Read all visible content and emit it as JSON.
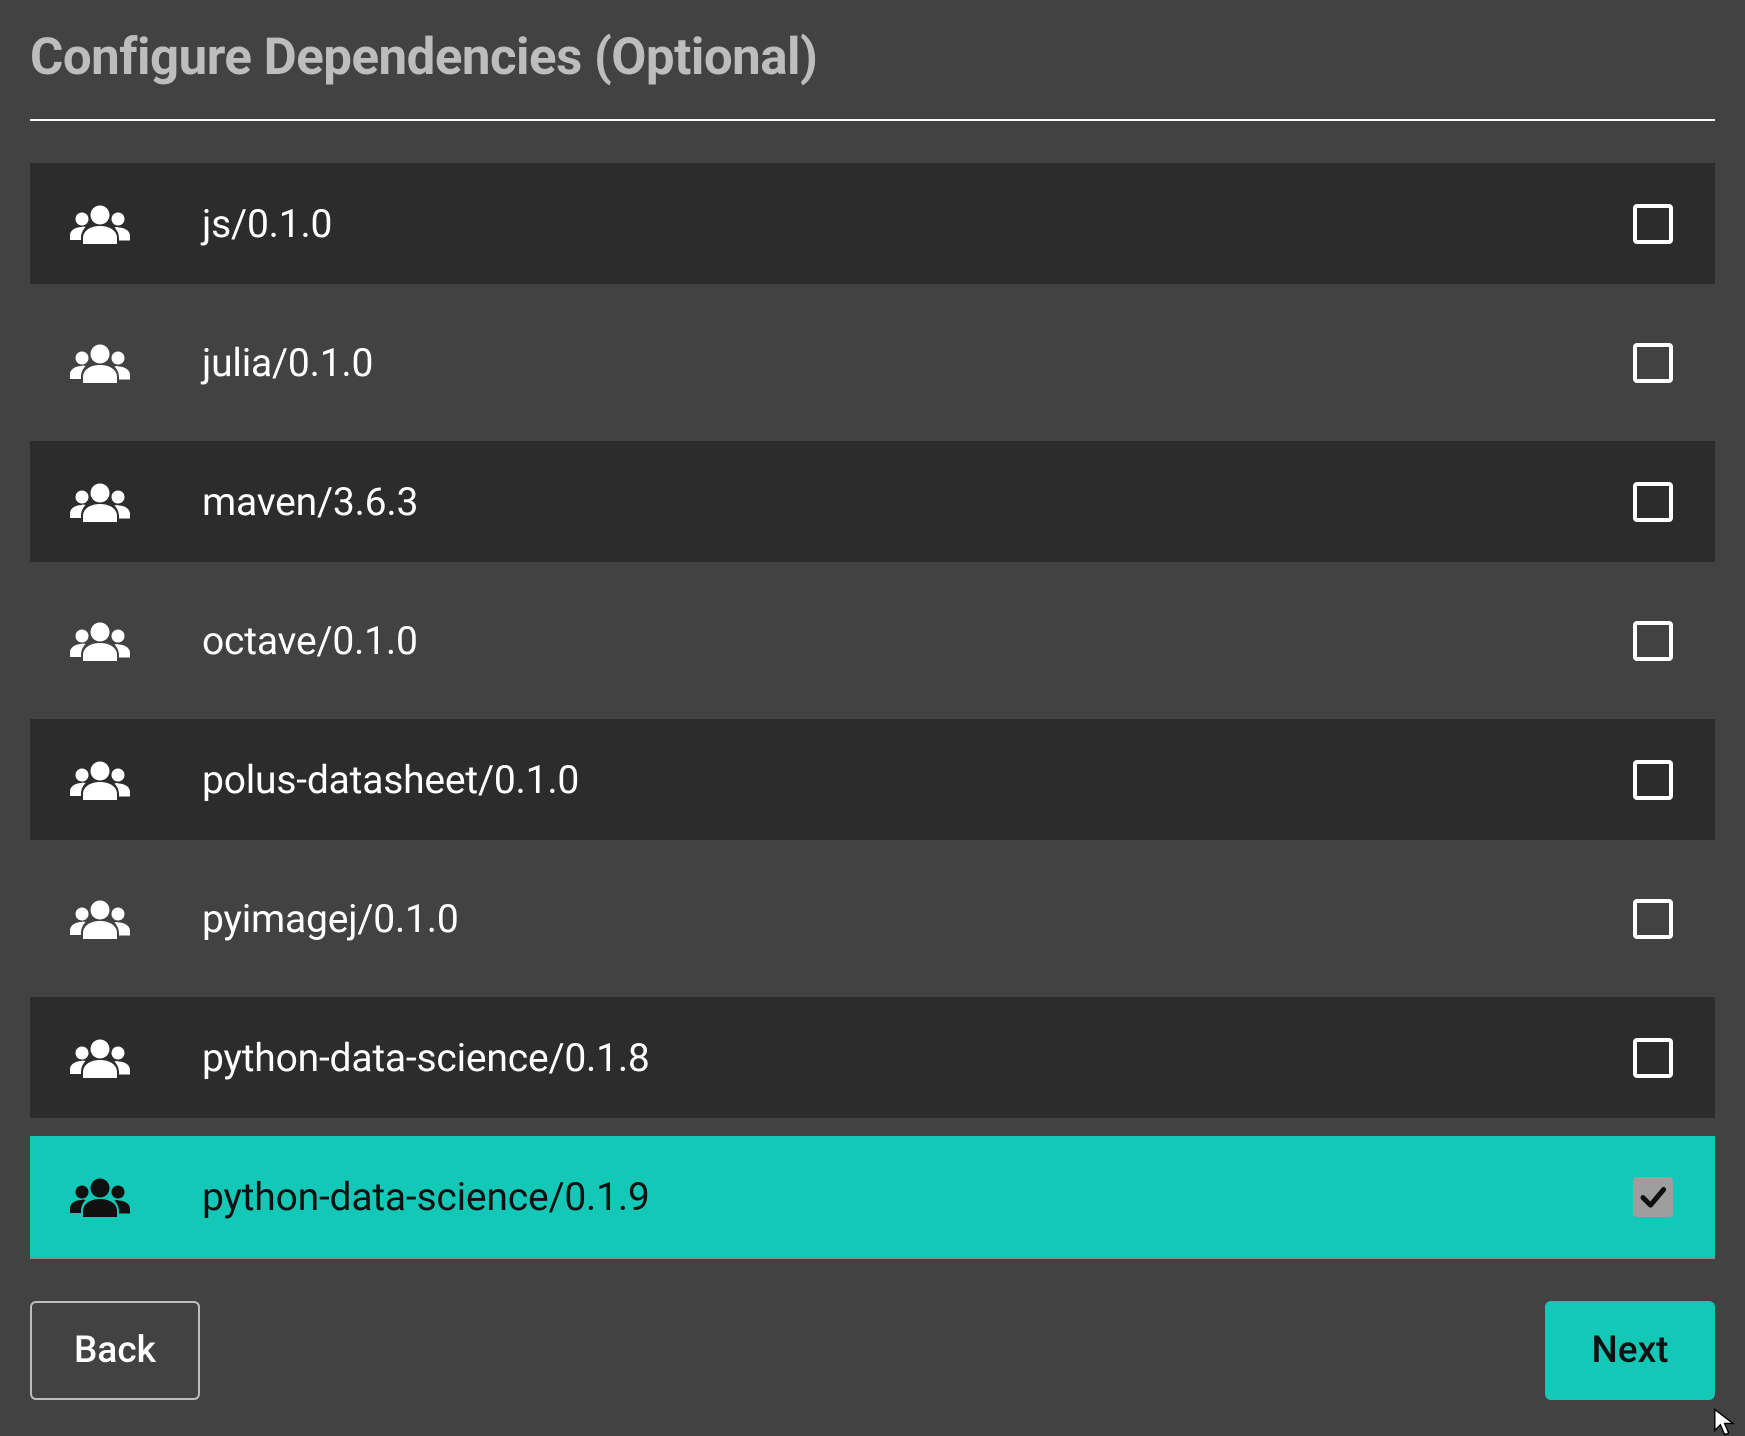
{
  "title": "Configure Dependencies (Optional)",
  "colors": {
    "accent": "#14c8b8"
  },
  "dependencies": [
    {
      "label": "js/0.1.0",
      "checked": false,
      "shade": "dark"
    },
    {
      "label": "julia/0.1.0",
      "checked": false,
      "shade": "light"
    },
    {
      "label": "maven/3.6.3",
      "checked": false,
      "shade": "dark"
    },
    {
      "label": "octave/0.1.0",
      "checked": false,
      "shade": "light"
    },
    {
      "label": "polus-datasheet/0.1.0",
      "checked": false,
      "shade": "dark"
    },
    {
      "label": "pyimagej/0.1.0",
      "checked": false,
      "shade": "light"
    },
    {
      "label": "python-data-science/0.1.8",
      "checked": false,
      "shade": "dark"
    },
    {
      "label": "python-data-science/0.1.9",
      "checked": true,
      "shade": "accent"
    }
  ],
  "buttons": {
    "back": "Back",
    "next": "Next"
  }
}
